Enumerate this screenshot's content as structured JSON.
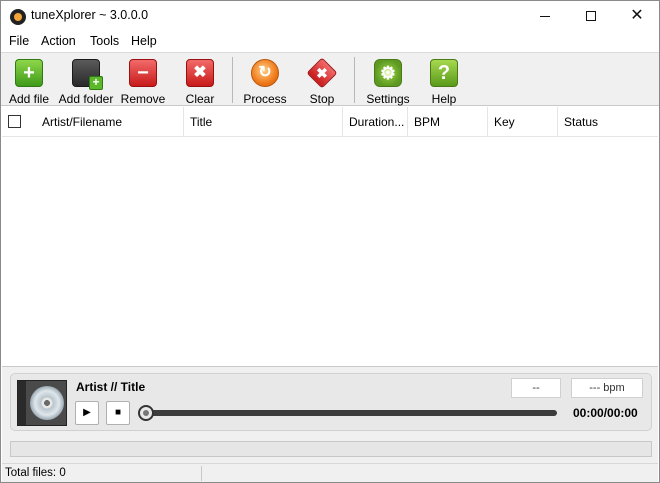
{
  "window": {
    "title": "tuneXplorer ~ 3.0.0.0"
  },
  "menu": [
    "File",
    "Action",
    "Tools",
    "Help"
  ],
  "toolbar": {
    "add_file": "Add file",
    "add_folder": "Add folder",
    "remove": "Remove",
    "clear": "Clear",
    "process": "Process",
    "stop": "Stop",
    "settings": "Settings",
    "help": "Help"
  },
  "columns": [
    "Artist/Filename",
    "Title",
    "Duration...",
    "BPM",
    "Key",
    "Status"
  ],
  "player": {
    "track": "Artist // Title",
    "key": "--",
    "bpm": "--- bpm",
    "time": "00:00/00:00",
    "progress": 0
  },
  "status": {
    "total_files": "Total files: 0"
  }
}
